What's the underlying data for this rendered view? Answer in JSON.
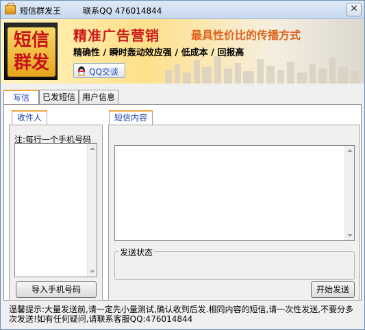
{
  "window": {
    "title": "短信群发王",
    "contact": "联系QQ 476014844"
  },
  "banner": {
    "logo_line1": "短信",
    "logo_line2": "群发",
    "slogan_main": "精准广告营销",
    "slogan_sub": "最具性价比的传播方式",
    "features": "精确性 / 瞬时轰动效应强 / 低成本 / 回报高",
    "qq_button": "QQ交谈"
  },
  "tabs": [
    {
      "label": "写信",
      "active": true
    },
    {
      "label": "已发短信",
      "active": false
    },
    {
      "label": "用户信息",
      "active": false
    }
  ],
  "recipients": {
    "tab_label": "收件人",
    "note": "注:每行一个手机号码",
    "import_button": "导入手机号码"
  },
  "message": {
    "tab_label": "短信内容",
    "status_label": "发送状态",
    "send_button": "开始发送"
  },
  "footer": {
    "tip": "温馨提示:大量发送前,请一定先小量测试,确认收到后发.相同内容的短信,请一次性发送,不要分多次发送!如有任何疑问,请联系客服QQ:476014844"
  },
  "colors": {
    "accent_tab": "#f3a33b",
    "slogan_red": "#cc1a1a",
    "slogan_orange": "#e0621a",
    "link_blue": "#1a3fb5"
  }
}
